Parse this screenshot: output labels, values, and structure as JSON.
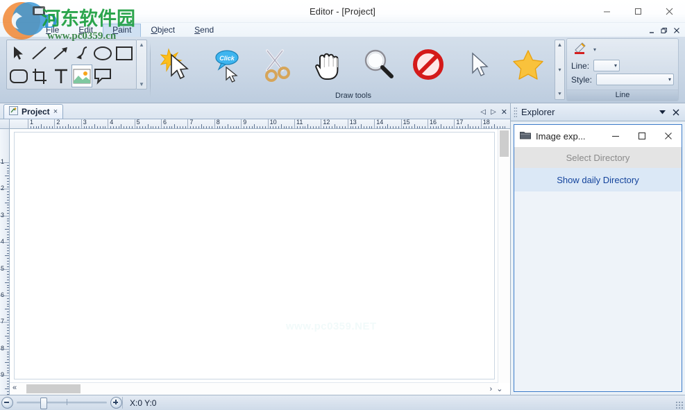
{
  "window": {
    "title": "Editor - [Project]",
    "controls": {
      "minimize": "minimize-icon",
      "maximize": "maximize-icon",
      "close": "close-icon"
    }
  },
  "mdi_controls": {
    "minimize": "mdi-minimize-icon",
    "restore": "mdi-restore-icon",
    "close": "mdi-close-icon"
  },
  "menubar": {
    "items": [
      {
        "label": "File",
        "mnemonic": "F",
        "active": false
      },
      {
        "label": "Edit",
        "mnemonic": "E",
        "active": false
      },
      {
        "label": "Paint",
        "mnemonic": "P",
        "active": true
      },
      {
        "label": "Object",
        "mnemonic": "O",
        "active": false
      },
      {
        "label": "Send",
        "mnemonic": "S",
        "active": false
      }
    ]
  },
  "ribbon": {
    "shapes_gallery": {
      "items": [
        {
          "name": "arrow-pointer-shape",
          "selected": false
        },
        {
          "name": "line-shape",
          "selected": false
        },
        {
          "name": "arrow-line-shape",
          "selected": false
        },
        {
          "name": "curve-arrow-shape",
          "selected": false
        },
        {
          "name": "ellipse-shape",
          "selected": false
        },
        {
          "name": "rectangle-shape",
          "selected": false
        },
        {
          "name": "rounded-rect-shape",
          "selected": false
        },
        {
          "name": "crop-shape",
          "selected": false
        },
        {
          "name": "text-shape",
          "selected": false
        },
        {
          "name": "image-shape",
          "selected": true
        },
        {
          "name": "callout-shape",
          "selected": false
        },
        {
          "name": "empty-shape",
          "selected": false
        }
      ]
    },
    "draw_tools": {
      "label": "Draw tools",
      "buttons": [
        {
          "name": "highlight-cursor-tool",
          "icon": "star-cursor-icon"
        },
        {
          "name": "click-callout-tool",
          "icon": "click-bubble-cursor-icon"
        },
        {
          "name": "cut-tool",
          "icon": "scissors-icon"
        },
        {
          "name": "hand-tool",
          "icon": "hand-icon"
        },
        {
          "name": "zoom-tool",
          "icon": "magnifier-icon"
        },
        {
          "name": "forbidden-tool",
          "icon": "no-entry-icon"
        },
        {
          "name": "select-tool",
          "icon": "arrow-cursor-icon"
        },
        {
          "name": "favorite-tool",
          "icon": "star-icon"
        }
      ]
    },
    "line_group": {
      "label": "Line",
      "brush_button": "brush-icon",
      "fields": [
        {
          "label": "Line:",
          "value": "",
          "name": "line-width-combo"
        },
        {
          "label": "Style:",
          "value": "",
          "name": "line-style-combo"
        }
      ]
    }
  },
  "document": {
    "tab": {
      "label": "Project",
      "close": "×",
      "icon": "project-doc-icon"
    },
    "tab_nav": {
      "prev": "◁",
      "next": "▷",
      "close": "✕"
    },
    "ruler": {
      "horizontal": [
        "1",
        "2",
        "3",
        "4",
        "5",
        "6",
        "7",
        "8",
        "9",
        "10",
        "11",
        "12",
        "13",
        "14",
        "15",
        "16",
        "17",
        "18"
      ],
      "vertical": [
        "1",
        "2",
        "3",
        "4",
        "5",
        "6",
        "7",
        "8",
        "9"
      ]
    },
    "canvas_watermark": "www.pc0359.NET",
    "scroll": {
      "left_arrow": "«",
      "right_arrow": "›",
      "down_arrow": "⌄"
    }
  },
  "explorer": {
    "title": "Explorer",
    "collapse_icon": "chevron-down-icon",
    "close_icon": "close-icon",
    "child_window": {
      "title": "Image exp...",
      "icon": "folder-icon",
      "minimize": "minimize-icon",
      "maximize": "maximize-icon",
      "close": "close-icon",
      "select_directory": "Select Directory",
      "show_daily_directory": "Show daily Directory"
    }
  },
  "statusbar": {
    "zoom": {
      "minus": "zoom-out-icon",
      "plus": "zoom-in-icon",
      "value_percent": 26
    },
    "coordinates": "X:0 Y:0"
  },
  "watermark": {
    "site_cn": "河东软件园",
    "site_url": "www.pc0359.cn"
  },
  "colors": {
    "accent_blue": "#3d7cc9",
    "link_blue": "#13439c",
    "ribbon_bg": "#c9d6e5",
    "panel_bg": "#eaf1f8"
  }
}
